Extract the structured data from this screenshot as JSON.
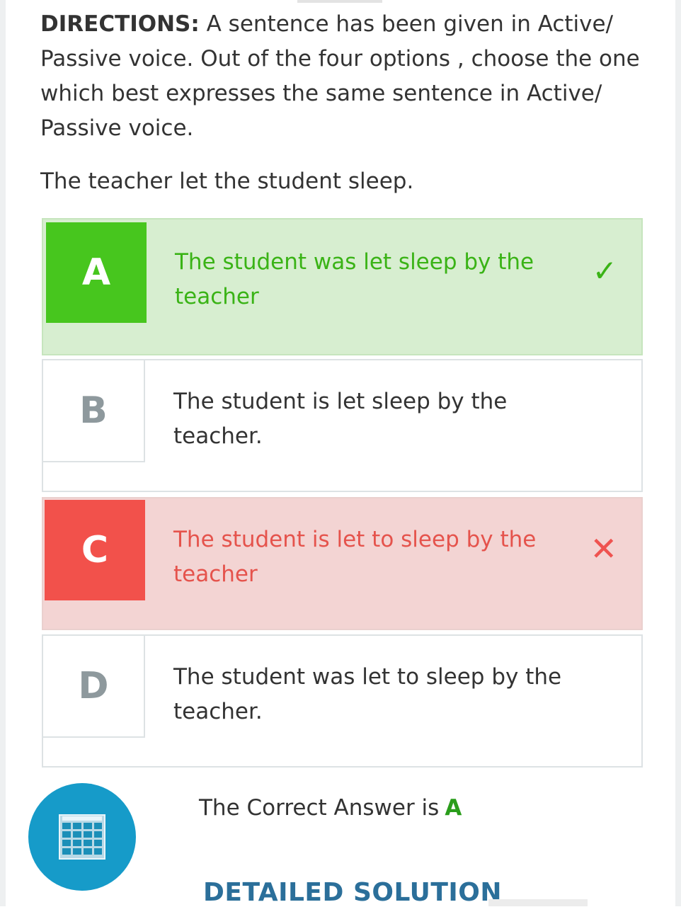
{
  "directions": {
    "label": "DIRECTIONS:",
    "text": " A sentence has been given in Active/ Passive voice. Out of the four options , choose the one which best expresses the same sentence in Active/ Passive voice."
  },
  "question": "The teacher let the student sleep.",
  "options": [
    {
      "letter": "A",
      "text": "The student was let sleep by the teacher",
      "state": "correct",
      "mark_icon": "check-icon",
      "mark": "✓"
    },
    {
      "letter": "B",
      "text": "The student is let sleep by the teacher.",
      "state": "neutral"
    },
    {
      "letter": "C",
      "text": "The student is let to sleep by the teacher",
      "state": "incorrect",
      "mark_icon": "cross-icon",
      "mark": "✕"
    },
    {
      "letter": "D",
      "text": "The student was let to sleep by the teacher.",
      "state": "neutral"
    }
  ],
  "result": {
    "prefix": "The Correct Answer is",
    "answer": "A"
  },
  "detailed_solution_label": "DETAILED SOLUTION",
  "fab": {
    "icon": "calculator-icon"
  },
  "colors": {
    "correct": "#47c61e",
    "correct_bg": "#d7eed0",
    "incorrect": "#f2514b",
    "incorrect_bg": "#f3d4d3",
    "fab": "#169bc9",
    "link": "#2b6f9a"
  }
}
